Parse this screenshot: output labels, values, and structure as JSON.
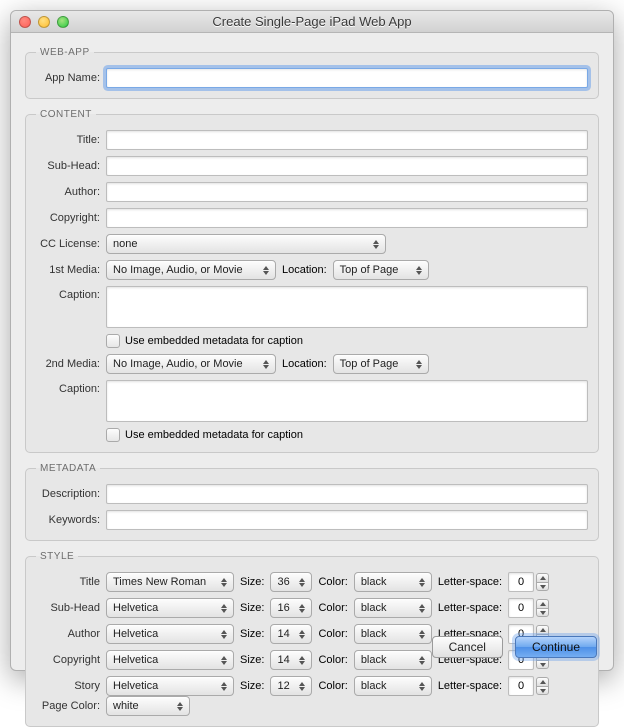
{
  "window": {
    "title": "Create Single-Page iPad Web App"
  },
  "webapp": {
    "legend": "WEB-APP",
    "appNameLabel": "App Name:",
    "appName": ""
  },
  "content": {
    "legend": "CONTENT",
    "titleLabel": "Title:",
    "title": "",
    "subheadLabel": "Sub-Head:",
    "subhead": "",
    "authorLabel": "Author:",
    "author": "",
    "copyrightLabel": "Copyright:",
    "copyright": "",
    "ccLabel": "CC License:",
    "cc": "none",
    "media1Label": "1st Media:",
    "media1": "No Image, Audio, or Movie",
    "locationLabel": "Location:",
    "location1": "Top of Page",
    "caption1Label": "Caption:",
    "caption1": "",
    "embedded1": "Use embedded metadata for caption",
    "media2Label": "2nd Media:",
    "media2": "No Image, Audio, or Movie",
    "location2": "Top of Page",
    "caption2Label": "Caption:",
    "caption2": "",
    "embedded2": "Use embedded metadata for caption"
  },
  "metadata": {
    "legend": "METADATA",
    "descLabel": "Description:",
    "desc": "",
    "keywordsLabel": "Keywords:",
    "keywords": ""
  },
  "style": {
    "legend": "STYLE",
    "sizeLabel": "Size:",
    "colorLabel": "Color:",
    "letterLabel": "Letter-space:",
    "rows": [
      {
        "label": "Title",
        "font": "Times New Roman",
        "size": "36",
        "color": "black",
        "ls": "0"
      },
      {
        "label": "Sub-Head",
        "font": "Helvetica",
        "size": "16",
        "color": "black",
        "ls": "0"
      },
      {
        "label": "Author",
        "font": "Helvetica",
        "size": "14",
        "color": "black",
        "ls": "0"
      },
      {
        "label": "Copyright",
        "font": "Helvetica",
        "size": "14",
        "color": "black",
        "ls": "0"
      },
      {
        "label": "Story",
        "font": "Helvetica",
        "size": "12",
        "color": "black",
        "ls": "0"
      }
    ],
    "pageColorLabel": "Page Color:",
    "pageColor": "white"
  },
  "buttons": {
    "cancel": "Cancel",
    "continue": "Continue"
  }
}
